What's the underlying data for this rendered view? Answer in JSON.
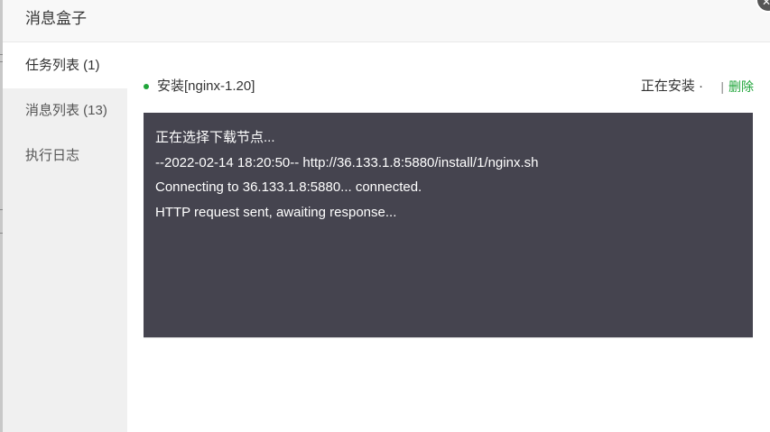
{
  "dialog": {
    "title": "消息盒子",
    "close_icon": "close-icon"
  },
  "sidebar": {
    "tabs": [
      {
        "label": "任务列表 (1)",
        "active": true
      },
      {
        "label": "消息列表 (13)",
        "active": false
      },
      {
        "label": "执行日志",
        "active": false
      }
    ]
  },
  "task": {
    "name": "安装[nginx-1.20]",
    "status": "正在安装 ·",
    "separator": "|",
    "delete_label": "删除"
  },
  "console": {
    "lines": [
      "正在选择下载节点...",
      "--2022-02-14 18:20:50-- http://36.133.1.8:5880/install/1/nginx.sh",
      "Connecting to 36.133.1.8:5880... connected.",
      "HTTP request sent, awaiting response..."
    ]
  },
  "colors": {
    "accent": "#20a53a",
    "console_bg": "#45444f"
  }
}
